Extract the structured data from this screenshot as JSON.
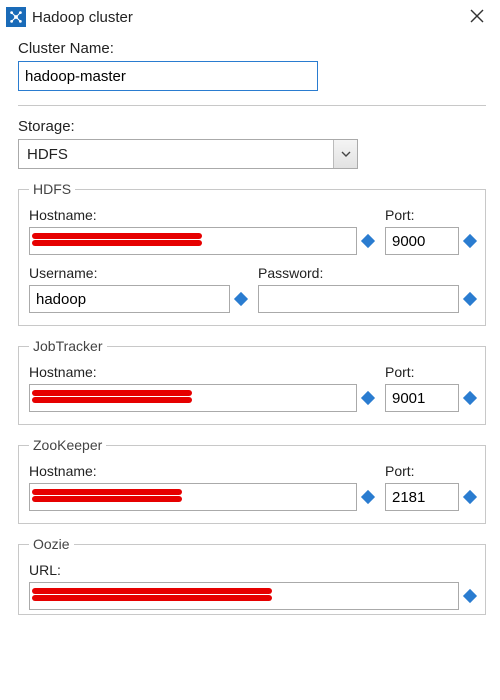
{
  "window": {
    "title": "Hadoop cluster"
  },
  "clusterName": {
    "label": "Cluster Name:",
    "value": "hadoop-master"
  },
  "storage": {
    "label": "Storage:",
    "selected": "HDFS"
  },
  "hdfs": {
    "legend": "HDFS",
    "hostnameLabel": "Hostname:",
    "hostnameValue": "",
    "portLabel": "Port:",
    "portValue": "9000",
    "usernameLabel": "Username:",
    "usernameValue": "hadoop",
    "passwordLabel": "Password:",
    "passwordValue": ""
  },
  "jobtracker": {
    "legend": "JobTracker",
    "hostnameLabel": "Hostname:",
    "hostnameValue": "",
    "portLabel": "Port:",
    "portValue": "9001"
  },
  "zookeeper": {
    "legend": "ZooKeeper",
    "hostnameLabel": "Hostname:",
    "hostnameValue": "",
    "portLabel": "Port:",
    "portValue": "2181"
  },
  "oozie": {
    "legend": "Oozie",
    "urlLabel": "URL:",
    "urlValue": ""
  }
}
